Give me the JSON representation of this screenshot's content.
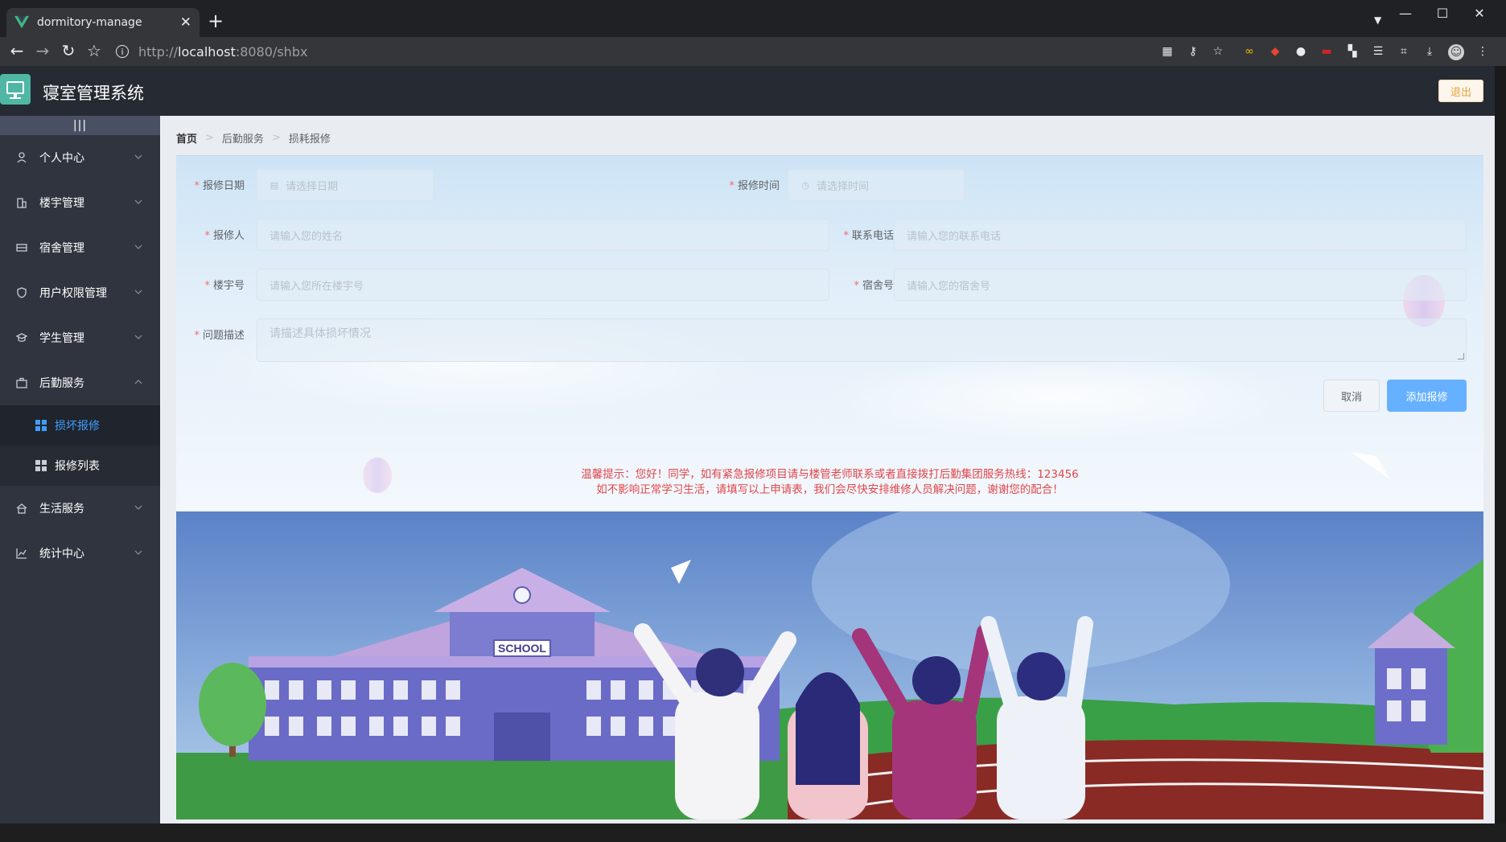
{
  "browser": {
    "tab_title": "dormitory-manage",
    "url_prefix": "http://",
    "url_host": "localhost",
    "url_rest": ":8080/shbx"
  },
  "header": {
    "title": "寝室管理系统",
    "logout": "退出"
  },
  "sidebar": {
    "items": [
      {
        "label": "个人中心",
        "icon": "user-icon"
      },
      {
        "label": "楼宇管理",
        "icon": "building-icon"
      },
      {
        "label": "宿舍管理",
        "icon": "bed-icon"
      },
      {
        "label": "用户权限管理",
        "icon": "shield-icon"
      },
      {
        "label": "学生管理",
        "icon": "graduation-cap-icon"
      },
      {
        "label": "后勤服务",
        "icon": "briefcase-icon",
        "expanded": true
      },
      {
        "label": "生活服务",
        "icon": "home-icon"
      },
      {
        "label": "统计中心",
        "icon": "chart-icon"
      }
    ],
    "sub_items": [
      {
        "label": "损坏报修",
        "active": true
      },
      {
        "label": "报修列表",
        "active": false
      }
    ]
  },
  "breadcrumb": [
    "首页",
    "后勤服务",
    "损耗报修"
  ],
  "form": {
    "date": {
      "label": "报修日期",
      "placeholder": "请选择日期"
    },
    "time": {
      "label": "报修时间",
      "placeholder": "请选择时间"
    },
    "name": {
      "label": "报修人",
      "placeholder": "请输入您的姓名"
    },
    "phone": {
      "label": "联系电话",
      "placeholder": "请输入您的联系电话"
    },
    "building": {
      "label": "楼宇号",
      "placeholder": "请输入您所在楼宇号"
    },
    "room": {
      "label": "宿舍号",
      "placeholder": "请输入您的宿舍号"
    },
    "desc": {
      "label": "问题描述",
      "placeholder": "请描述具体损坏情况"
    },
    "cancel": "取消",
    "submit": "添加报修"
  },
  "tip": {
    "line1": "温馨提示：您好！同学，如有紧急报修项目请与楼管老师联系或者直接拨打后勤集团服务热线：123456",
    "line2": "如不影响正常学习生活，请填写以上申请表，我们会尽快安排维修人员解决问题，谢谢您的配合！"
  },
  "scene": {
    "sign": "SCHOOL"
  },
  "colors": {
    "sidebar_bg": "#2f343e",
    "header_bg": "#252a33",
    "active": "#409eff",
    "primary_button": "#66b1ff",
    "tip_text": "#e0464a",
    "logout": "#e6a23c"
  }
}
